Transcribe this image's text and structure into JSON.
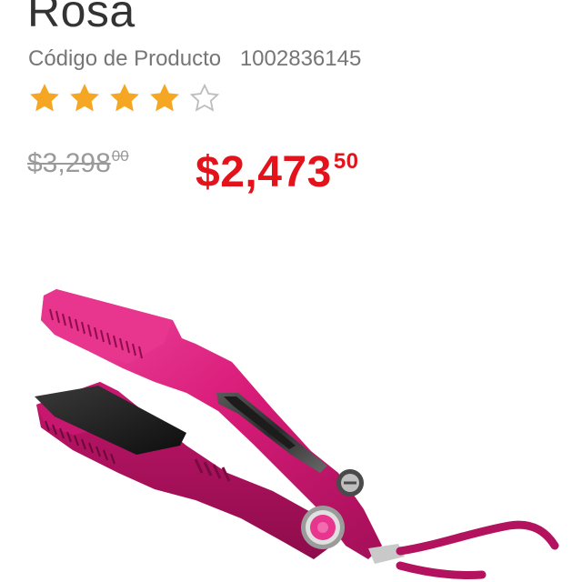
{
  "product": {
    "title": "Rosa",
    "code_label": "Código de Producto",
    "code_value": "1002836145",
    "rating": {
      "value": 4,
      "max": 5,
      "filled_color": "#f5a623",
      "empty_color": "#bdbdbd",
      "icons": [
        "star-filled-icon",
        "star-filled-icon",
        "star-filled-icon",
        "star-filled-icon",
        "star-outline-icon"
      ]
    },
    "old_price": {
      "main": "$3,298",
      "cents": "00"
    },
    "new_price": {
      "main": "$2,473",
      "cents": "50"
    },
    "colors": {
      "title": "#333333",
      "old_price": "#9a9a9a",
      "new_price": "#e4121a",
      "product_body": "#d81b78"
    }
  }
}
